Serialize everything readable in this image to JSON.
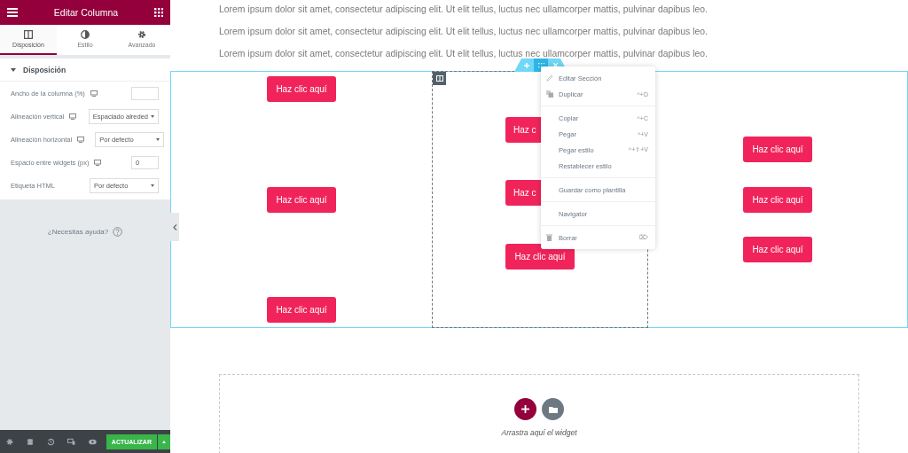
{
  "panel": {
    "title": "Editar Columna",
    "tabs": [
      {
        "label": "Disposición",
        "selected": true
      },
      {
        "label": "Estilo",
        "selected": false
      },
      {
        "label": "Avanzado",
        "selected": false
      }
    ],
    "section": {
      "title": "Disposición",
      "expanded": true
    },
    "controls": [
      {
        "kind": "number",
        "label": "Ancho de la columna (%)",
        "responsive": true
      },
      {
        "kind": "select",
        "label": "Alineación vertical",
        "responsive": true,
        "value": "Espaciado alreded"
      },
      {
        "kind": "select",
        "label": "Alineación horizontal",
        "responsive": true,
        "value": "Por defecto"
      },
      {
        "kind": "number",
        "label": "Espacio entre widgets (px)",
        "responsive": true,
        "value": "0"
      },
      {
        "kind": "select",
        "label": "Etiqueta HTML",
        "responsive": false,
        "value": "Por defecto"
      }
    ],
    "help": "¿Necesitas ayuda?",
    "publish": "ACTUALIZAR"
  },
  "canvas": {
    "paragraphs": [
      "Lorem ipsum dolor sit amet, consectetur adipiscing elit. Ut elit tellus, luctus nec ullamcorper mattis, pulvinar dapibus leo.",
      "Lorem ipsum dolor sit amet, consectetur adipiscing elit. Ut elit tellus, luctus nec ullamcorper mattis, pulvinar dapibus leo.",
      "Lorem ipsum dolor sit amet, consectetur adipiscing elit. Ut elit tellus, luctus nec ullamcorper mattis, pulvinar dapibus leo."
    ],
    "columns": [
      {
        "selected": false,
        "buttons": [
          "Haz clic aquí",
          "Haz clic aquí",
          "Haz clic aquí"
        ]
      },
      {
        "selected": true,
        "buttons": [
          "Haz c",
          "Haz c",
          "Haz clic aquí"
        ]
      },
      {
        "selected": false,
        "buttons": [
          "Haz clic aquí",
          "Haz clic aquí",
          "Haz clic aquí"
        ]
      }
    ],
    "context_menu": [
      [
        {
          "kind": "edit",
          "label": "Editar Sección"
        },
        {
          "kind": "duplicate",
          "label": "Duplicar",
          "shortcut": "^+D"
        }
      ],
      [
        {
          "kind": "plain",
          "label": "Copiar",
          "shortcut": "^+C"
        },
        {
          "kind": "plain",
          "label": "Pegar",
          "shortcut": "^+V"
        },
        {
          "kind": "plain",
          "label": "Pegar estilo",
          "shortcut": "^+⇧+V"
        },
        {
          "kind": "plain",
          "label": "Restablecer estilo"
        }
      ],
      [
        {
          "kind": "plain",
          "label": "Guardar como plantilla"
        }
      ],
      [
        {
          "kind": "plain",
          "label": "Navigator"
        }
      ],
      [
        {
          "kind": "delete",
          "label": "Borrar",
          "shortcut": "⌦"
        }
      ]
    ],
    "dropzone": {
      "hint": "Arrastra aquí el widget"
    }
  }
}
